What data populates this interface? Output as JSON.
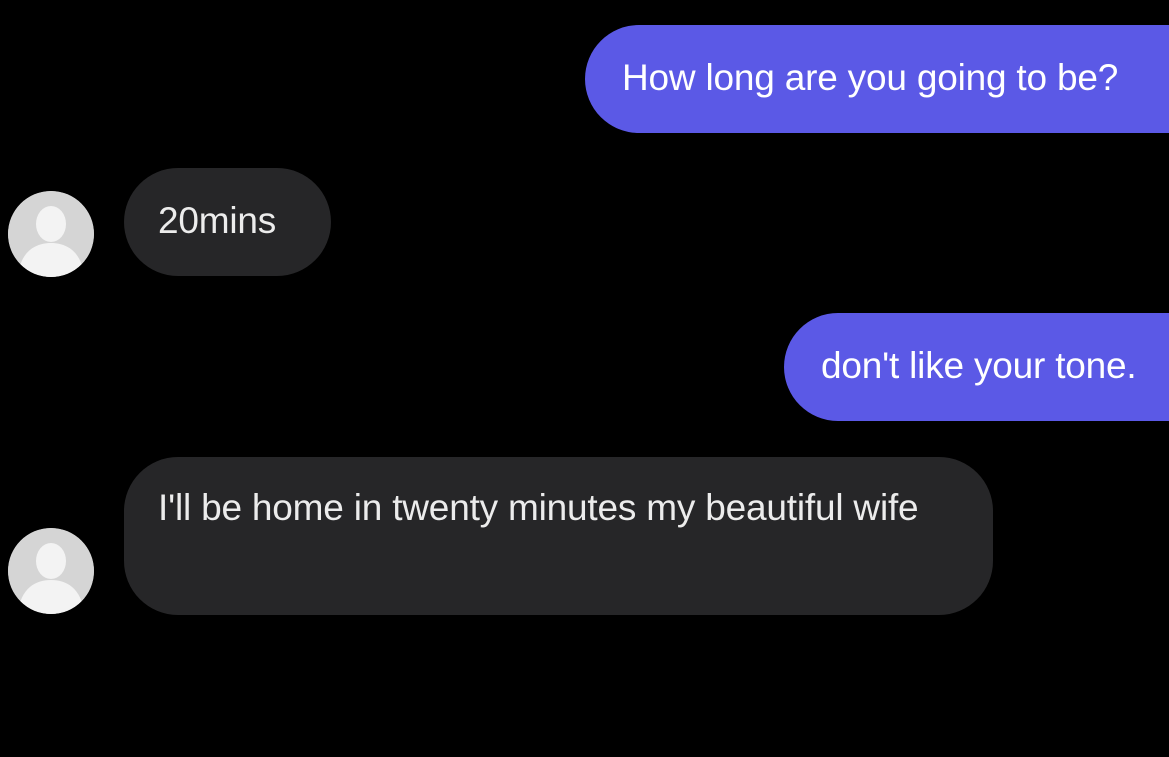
{
  "conversation": {
    "messages": [
      {
        "sender": "me",
        "text": "How long are you going to be?"
      },
      {
        "sender": "contact",
        "text": "20mins",
        "avatar_icon": "default-person-avatar-icon"
      },
      {
        "sender": "me",
        "text": "don't like your tone."
      },
      {
        "sender": "contact",
        "text": "I'll be home in twenty minutes my beautiful wife",
        "avatar_icon": "default-person-avatar-icon"
      }
    ]
  },
  "colors": {
    "background": "#000000",
    "outgoing_bubble": "#5b59e6",
    "incoming_bubble": "#262628",
    "avatar_background": "#d5d5d5",
    "avatar_silhouette": "#f3f3f3"
  }
}
